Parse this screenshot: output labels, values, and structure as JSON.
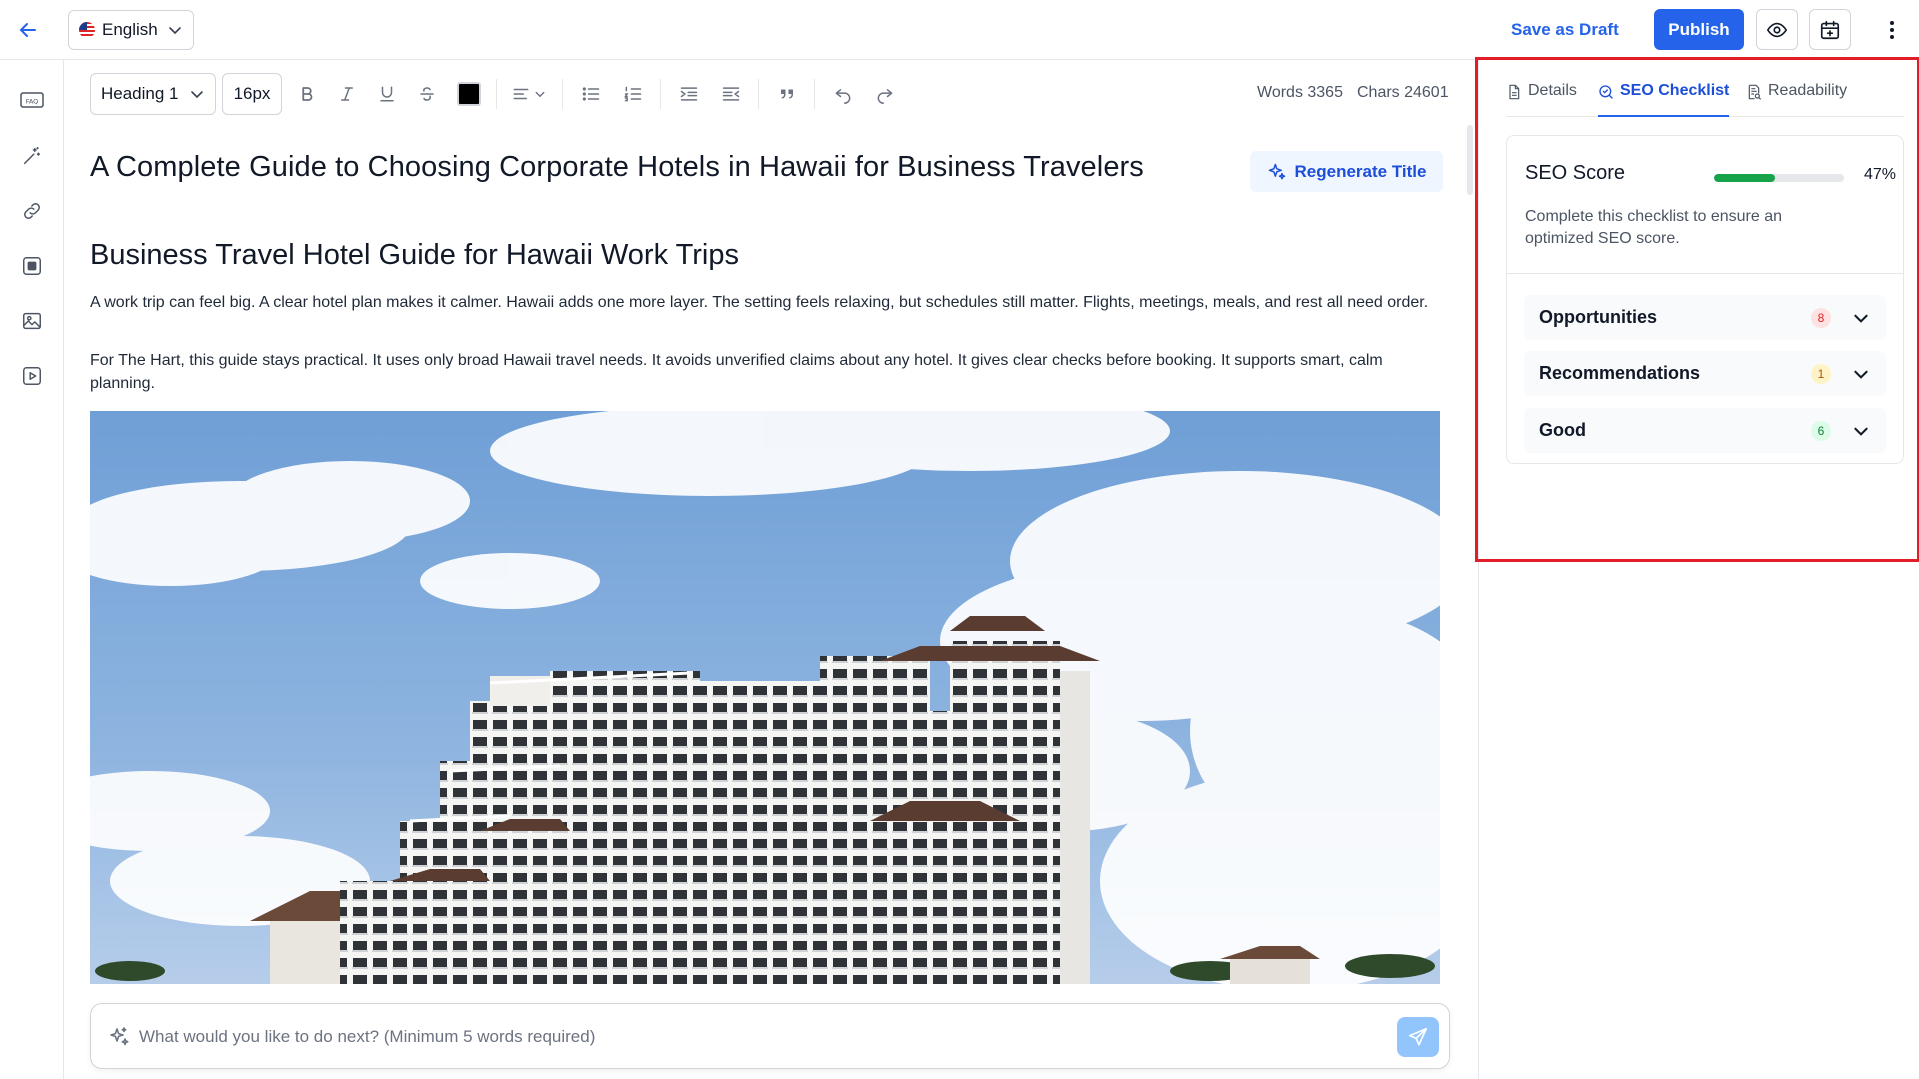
{
  "topbar": {
    "language": "English",
    "save_draft_label": "Save as Draft",
    "publish_label": "Publish"
  },
  "toolbar": {
    "block_style": "Heading 1",
    "font_size": "16px",
    "text_color": "#000000",
    "words_label": "Words 3365",
    "chars_label": "Chars 24601"
  },
  "document": {
    "title": "A Complete Guide to Choosing Corporate Hotels in Hawaii for Business Travelers",
    "regenerate_label": "Regenerate Title",
    "heading": "Business Travel Hotel Guide for Hawaii Work Trips",
    "paragraphs": [
      "A work trip can feel big. A clear hotel plan makes it calmer. Hawaii adds one more layer. The setting feels relaxing, but schedules still matter. Flights, meetings, meals, and rest all need order.",
      "For The Hart, this guide stays practical. It uses only broad Hawaii travel needs. It avoids unverified claims about any hotel. It gives clear checks before booking. It supports smart, calm planning."
    ]
  },
  "prompt": {
    "placeholder": "What would you like to do next? (Minimum 5 words required)"
  },
  "panel": {
    "tabs": [
      {
        "label": "Details",
        "icon": "document-icon",
        "active": false
      },
      {
        "label": "SEO Checklist",
        "icon": "magnify-check-icon",
        "active": true
      },
      {
        "label": "Readability",
        "icon": "readability-icon",
        "active": false
      }
    ],
    "seo": {
      "title": "SEO Score",
      "score_percent": 47,
      "score_label": "47%",
      "description": "Complete this checklist to ensure an optimized SEO score.",
      "bar_color": "#16a34a"
    },
    "sections": [
      {
        "label": "Opportunities",
        "count": "8",
        "badge_bg": "#fee2e2",
        "badge_fg": "#dc2626"
      },
      {
        "label": "Recommendations",
        "count": "1",
        "badge_bg": "#fef3c7",
        "badge_fg": "#b45309"
      },
      {
        "label": "Good",
        "count": "6",
        "badge_bg": "#dcfce7",
        "badge_fg": "#15803d"
      }
    ]
  },
  "colors": {
    "accent": "#2563eb",
    "highlight": "#e11d2a"
  }
}
